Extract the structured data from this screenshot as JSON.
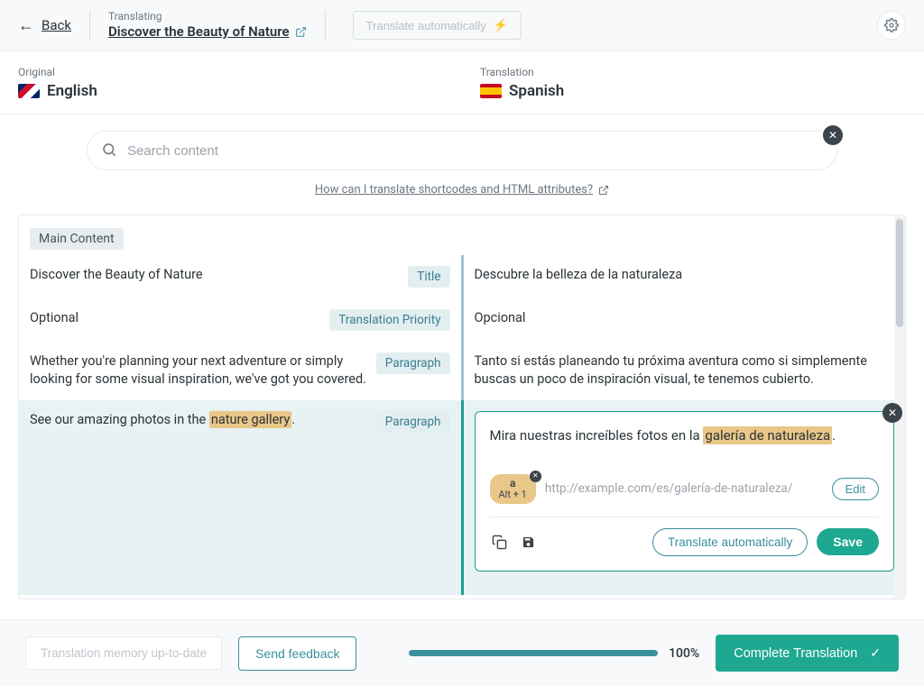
{
  "header": {
    "back_label": "Back",
    "translating_label": "Translating",
    "doc_title": "Discover the Beauty of Nature",
    "auto_translate_label": "Translate automatically"
  },
  "langs": {
    "original_label": "Original",
    "original_name": "English",
    "translation_label": "Translation",
    "translation_name": "Spanish"
  },
  "search": {
    "placeholder": "Search content"
  },
  "help_link": "How can I translate shortcodes and HTML attributes?",
  "section_label": "Main Content",
  "rows": [
    {
      "original": "Discover the Beauty of Nature",
      "badge": "Title",
      "translation": "Descubre la belleza de la naturaleza"
    },
    {
      "original": "Optional",
      "badge": "Translation Priority",
      "translation": "Opcional"
    },
    {
      "original": "Whether you're planning your next adventure or simply looking for some visual inspiration, we've got you covered.",
      "badge": "Paragraph",
      "translation": "Tanto si estás planeando tu próxima aventura como si simplemente buscas un poco de inspiración visual, te tenemos cubierto."
    },
    {
      "original_pre": "See our amazing photos in the ",
      "original_hl": "nature gallery",
      "badge": "Paragraph",
      "translation_pre": "Mira nuestras increíbles fotos en la ",
      "translation_hl": "galería de naturaleza"
    }
  ],
  "editor": {
    "alt_key_a": "a",
    "alt_key_combo": "Alt + 1",
    "url": "http://example.com/es/galería-de-naturaleza/",
    "edit_label": "Edit",
    "auto_label": "Translate automatically",
    "save_label": "Save"
  },
  "footer": {
    "memory_label": "Translation memory up-to-date",
    "feedback_label": "Send feedback",
    "progress_pct": "100%",
    "complete_label": "Complete Translation"
  }
}
